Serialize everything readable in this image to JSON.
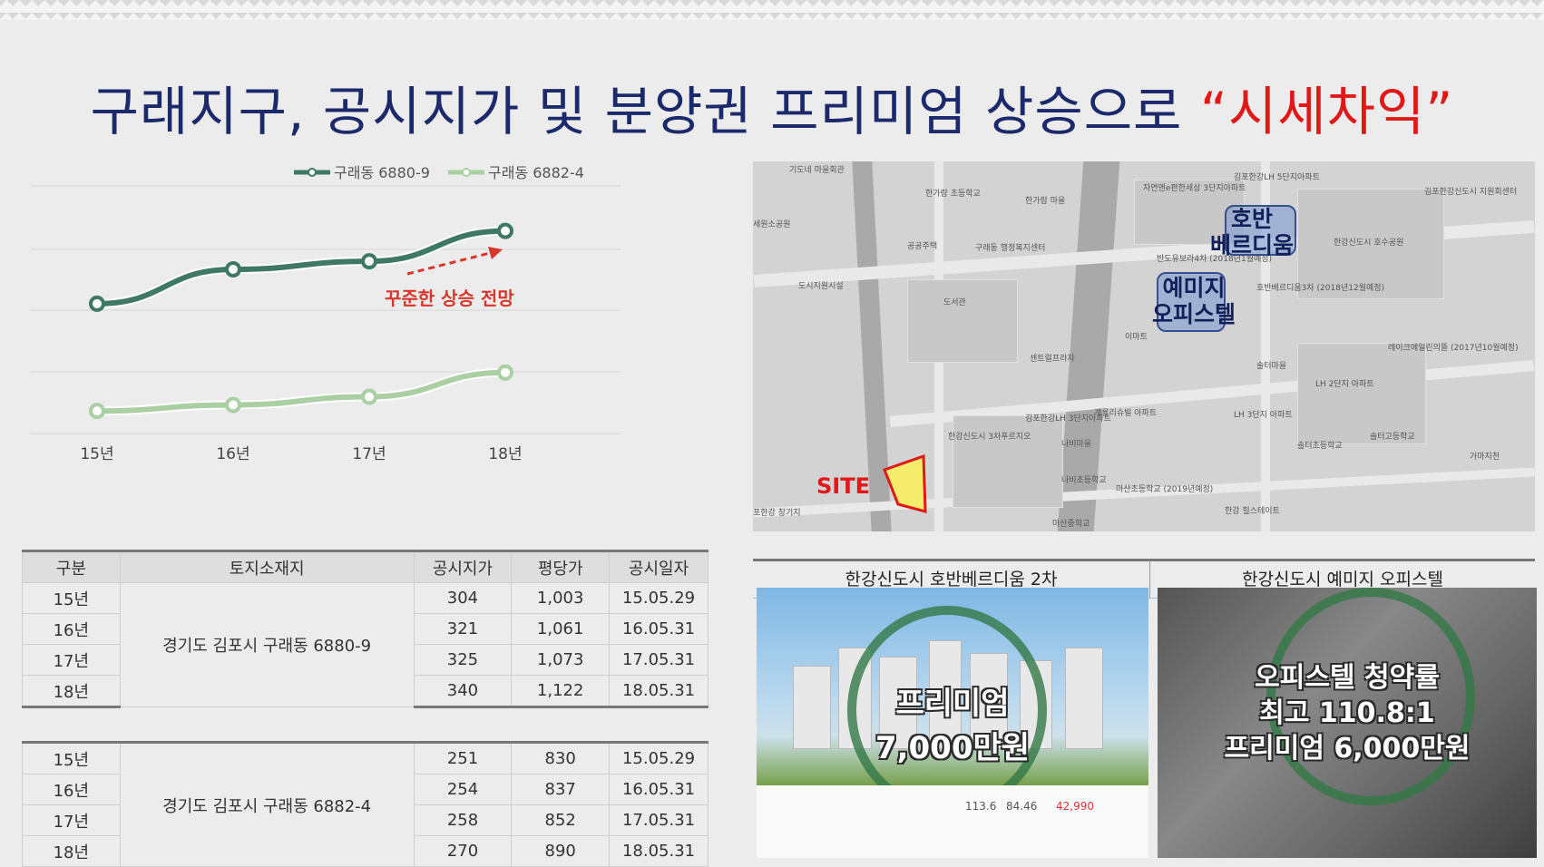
{
  "title": {
    "main": "구래지구, 공시지가 및 분양권 프리미엄 상승으로 ",
    "highlight": "“시세차익”"
  },
  "chart_data": {
    "type": "line",
    "categories": [
      "15년",
      "16년",
      "17년",
      "18년"
    ],
    "series": [
      {
        "name": "구래동 6880-9",
        "values": [
          304,
          321,
          325,
          340
        ],
        "color": "#3f7864"
      },
      {
        "name": "구래동 6882-4",
        "values": [
          251,
          254,
          258,
          270
        ],
        "color": "#a9cfa3"
      }
    ],
    "ylim": [
      230,
      360
    ],
    "legend": "top-right",
    "grid": true,
    "annotation": "꾸준한 상승 전망",
    "annotation_color": "#d9362b"
  },
  "table": {
    "headers": [
      "구분",
      "토지소재지",
      "공시지가",
      "평당가",
      "공시일자"
    ],
    "group1": {
      "location": "경기도 김포시 구래동 6880-9",
      "rows": [
        [
          "15년",
          "304",
          "1,003",
          "15.05.29"
        ],
        [
          "16년",
          "321",
          "1,061",
          "16.05.31"
        ],
        [
          "17년",
          "325",
          "1,073",
          "17.05.31"
        ],
        [
          "18년",
          "340",
          "1,122",
          "18.05.31"
        ]
      ]
    },
    "group2": {
      "location": "경기도 김포시 구래동 6882-4",
      "rows": [
        [
          "15년",
          "251",
          "830",
          "15.05.29"
        ],
        [
          "16년",
          "254",
          "837",
          "16.05.31"
        ],
        [
          "17년",
          "258",
          "852",
          "17.05.31"
        ],
        [
          "18년",
          "270",
          "890",
          "18.05.31"
        ]
      ]
    }
  },
  "map": {
    "box1": {
      "line1": "호반",
      "line2": "베르디움"
    },
    "box2": {
      "line1": "예미지",
      "line2": "오피스텔"
    },
    "site": "SITE",
    "labels": [
      "기도네 마을회관",
      "한가람 초등학교",
      "한가람 마을",
      "자연앤e편한세상 3단지아파트",
      "김포한강LH 5단지아파트",
      "김포한강신도시 지원회센터",
      "세원소공원",
      "공공주택",
      "구래동 행정복지센터",
      "반도유보라4차 (2018년1월예정)",
      "호반베르디움3차 (2018년12월예정)",
      "한강신도시 호수공원",
      "도시지원시설",
      "도서관",
      "이마트",
      "센트럴프라자",
      "솔터마을",
      "LH 2단지 아파트",
      "레이크에일린의뜰 (2017년10월예정)",
      "김포한강LH 3단지아파트",
      "계룡리슈빌 아파트",
      "한강신도시 3차푸르지오",
      "나비마을",
      "LH 3단지 아파트",
      "솔터초등학교",
      "솔터고등학교",
      "나비초등학교",
      "마산초등학교 (2019년예정)",
      "한강 힐스테이트",
      "마산중학교",
      "포한강 창기지",
      "가마지천"
    ]
  },
  "panels": {
    "left": {
      "title": "한강신도시 호반베르디움 2차",
      "overlay_line1": "프리미엄",
      "overlay_line2": "7,000만원",
      "strip_num1": "113.6",
      "strip_num2": "84.46",
      "strip_price": "42,990"
    },
    "right": {
      "title": "한강신도시 예미지 오피스텔",
      "overlay_line1": "오피스텔 청약률",
      "overlay_line2": "최고 110.8:1",
      "overlay_line3": "프리미엄 6,000만원"
    }
  }
}
